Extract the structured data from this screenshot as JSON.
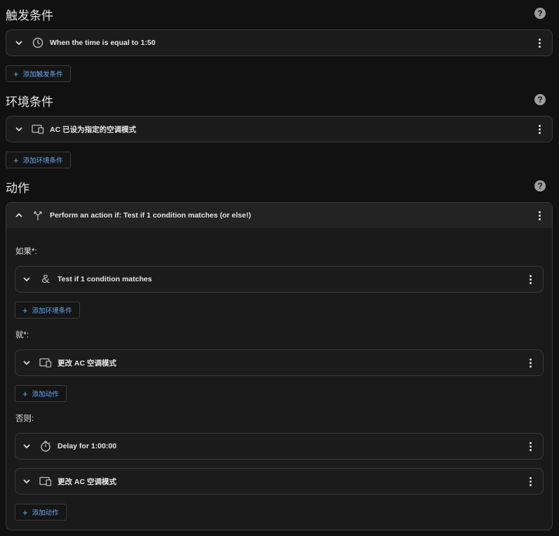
{
  "triggers": {
    "title": "触发条件",
    "items": [
      {
        "label": "When the time is equal to 1:50",
        "icon": "clock-icon"
      }
    ],
    "add_label": "添加触发条件"
  },
  "conditions": {
    "title": "环境条件",
    "items": [
      {
        "label": "AC 已设为指定的空调模式",
        "icon": "device-icon"
      }
    ],
    "add_label": "添加环境条件"
  },
  "actions": {
    "title": "动作",
    "if_then": {
      "label": "Perform an action if: Test if 1 condition matches (or else!)",
      "icon": "branch-icon",
      "if_label": "如果*:",
      "if_item": {
        "label": "Test if 1 condition matches",
        "icon": "ampersand-icon"
      },
      "if_add_label": "添加环境条件",
      "then_label": "就*:",
      "then_item": {
        "label": "更改 AC 空调模式",
        "icon": "device-icon"
      },
      "then_add_label": "添加动作",
      "else_label": "否则:",
      "else_items": [
        {
          "label": "Delay for 1:00:00",
          "icon": "timer-icon"
        },
        {
          "label": "更改 AC 空调模式",
          "icon": "device-icon"
        }
      ],
      "else_add_label": "添加动作"
    }
  },
  "help_glyph": "?",
  "colors": {
    "background": "#111111",
    "card": "#1c1c1c",
    "accent": "#6aaaf0",
    "border": "#3a3a3a"
  }
}
